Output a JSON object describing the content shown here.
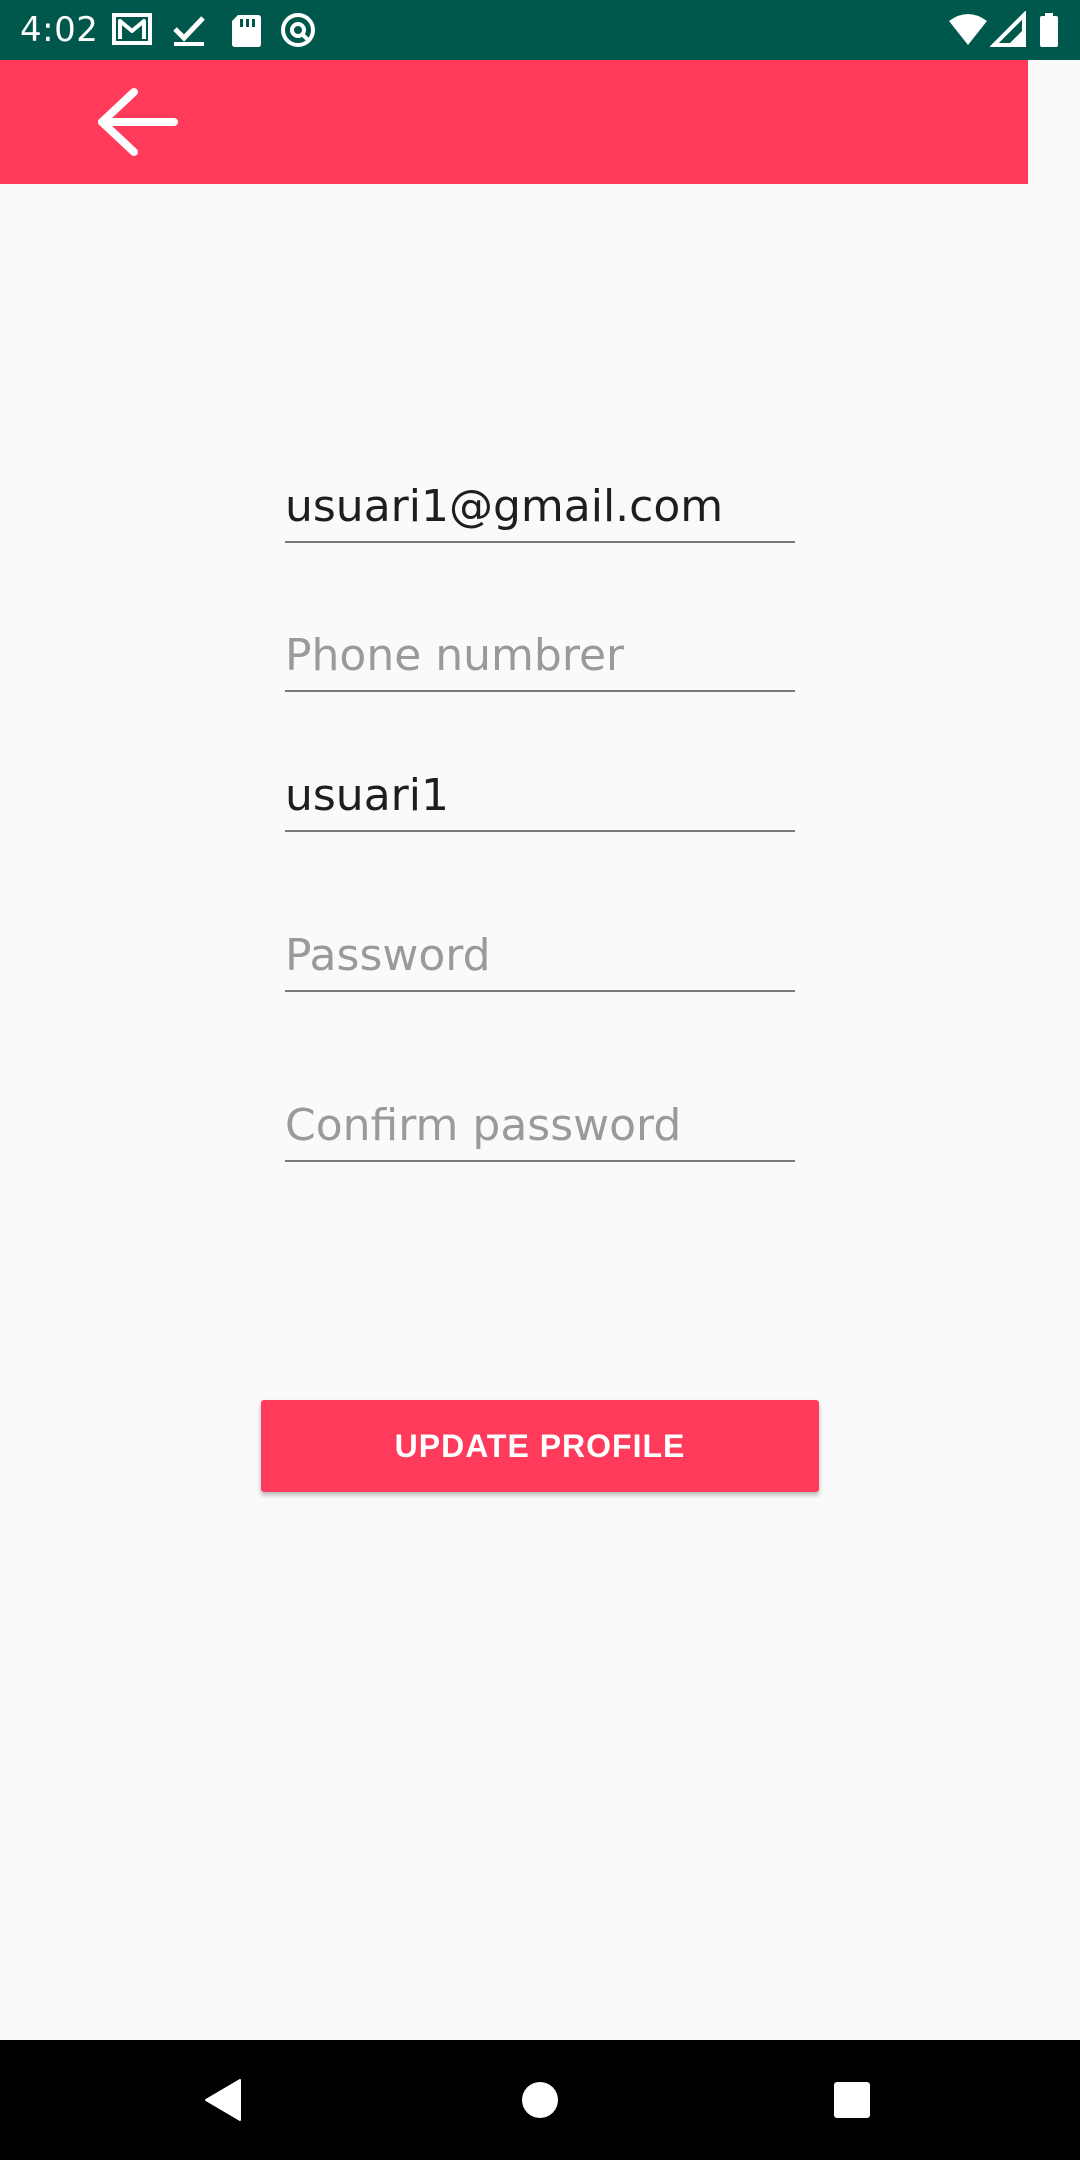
{
  "status_bar": {
    "time": "4:02",
    "notification_icons": [
      "gmail-icon",
      "task-check-icon",
      "sd-card-icon",
      "sync-circle-icon"
    ],
    "system_icons": [
      "wifi-icon",
      "cell-signal-icon",
      "battery-icon"
    ],
    "background_color": "#00574B"
  },
  "app_bar": {
    "back_icon": "arrow-back-icon",
    "background_color": "#FF3A5A"
  },
  "form": {
    "email": {
      "value": "usuari1@gmail.com",
      "placeholder": ""
    },
    "phone": {
      "value": "",
      "placeholder": "Phone numbrer"
    },
    "username": {
      "value": "usuari1",
      "placeholder": ""
    },
    "password": {
      "value": "",
      "placeholder": "Password"
    },
    "confirm_password": {
      "value": "",
      "placeholder": "Confirm password"
    }
  },
  "update_button": {
    "label": "UPDATE PROFILE",
    "color": "#FF3A5A"
  },
  "nav_bar": {
    "buttons": [
      "back-triangle-icon",
      "home-circle-icon",
      "recents-square-icon"
    ]
  }
}
